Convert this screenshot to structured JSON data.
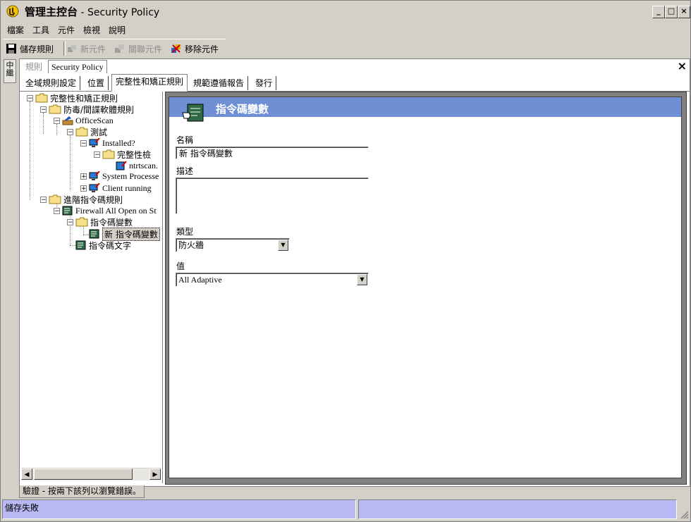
{
  "window": {
    "title_main": "管理主控台",
    "title_sub": " - Security Policy",
    "controls": {
      "minimize": "_",
      "maximize": "□",
      "close": "×"
    }
  },
  "menu": [
    "檔案",
    "工具",
    "元件",
    "檢視",
    "說明"
  ],
  "toolbar": {
    "save": "儲存規則",
    "new_component": "新元件",
    "link_component": "關聯元件",
    "remove_component": "移除元件"
  },
  "side_tab": {
    "label": "中繼"
  },
  "doc_tabs": {
    "inactive": "規則",
    "active": "Security Policy",
    "close": "×"
  },
  "inner_tabs": [
    "全域規則設定",
    "位置",
    "完整性和矯正規則",
    "規範遵循報告",
    "發行"
  ],
  "tree": [
    {
      "label": "完整性和矯正規則",
      "serif": false
    },
    {
      "label": "防毒/間諜軟體規則",
      "serif": false
    },
    {
      "label": "OfficeScan",
      "serif": true
    },
    {
      "label": "測試",
      "serif": false
    },
    {
      "label": "Installed?",
      "serif": true
    },
    {
      "label": "完整性檢",
      "serif": false
    },
    {
      "label": "ntrtscan.",
      "serif": true
    },
    {
      "label": "System Processe",
      "serif": true
    },
    {
      "label": "Client running",
      "serif": true
    },
    {
      "label": "進階指令碼規則",
      "serif": false
    },
    {
      "label": "Firewall All Open on St",
      "serif": true
    },
    {
      "label": "指令碼變數",
      "serif": false
    },
    {
      "label": "新 指令碼變數",
      "serif": false
    },
    {
      "label": "指令碼文字",
      "serif": false
    }
  ],
  "detail": {
    "title": "指令碼變數",
    "name_label": "名稱",
    "name_value": "新 指令碼變數",
    "desc_label": "描述",
    "desc_value": "",
    "type_label": "類型",
    "type_value": "防火牆",
    "value_label": "值",
    "value_value": "All Adaptive"
  },
  "bottom_tab": "驗證 - 按兩下該列以瀏覽錯誤。",
  "status": {
    "left": "儲存失敗",
    "right": ""
  },
  "colors": {
    "header": "#6e8fd4",
    "status": "#b8b8f4",
    "chrome": "#d4d0c8"
  }
}
